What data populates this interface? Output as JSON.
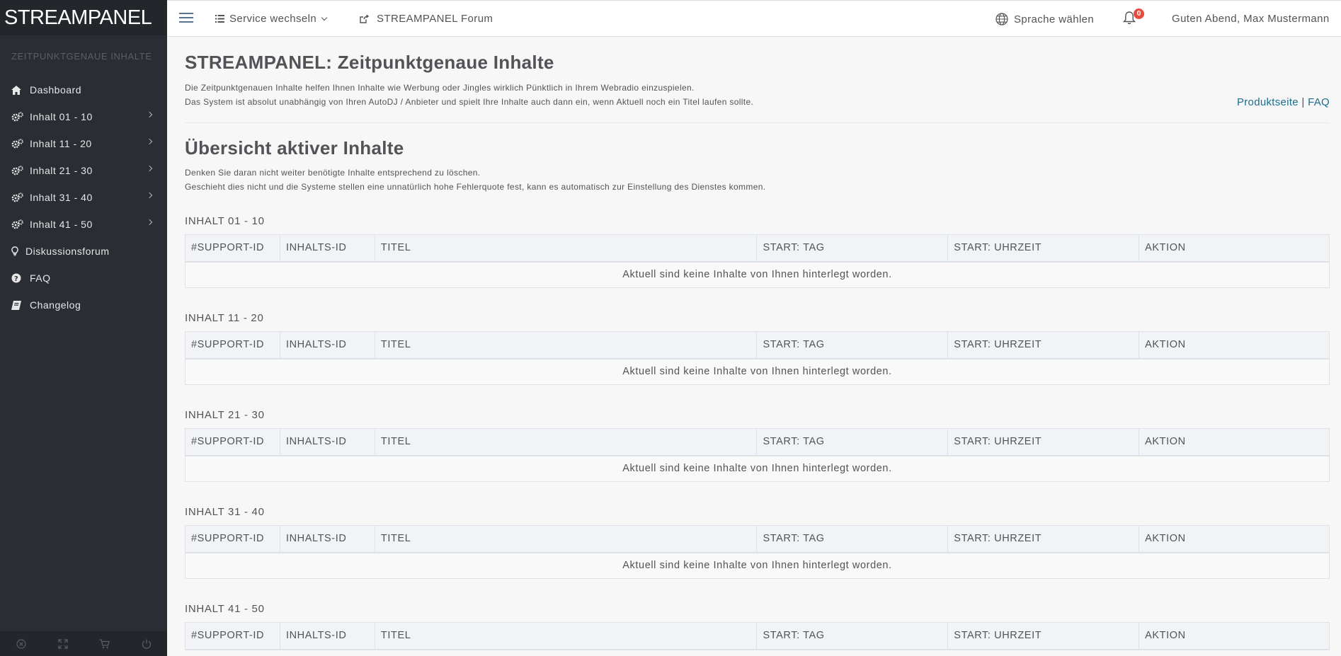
{
  "brand": "STREAMPANEL",
  "sidebar": {
    "section_title": "ZEITPUNKTGENAUE INHALTE",
    "items": [
      {
        "label": "Dashboard",
        "icon": "home-icon"
      },
      {
        "label": "Inhalt 01 - 10",
        "icon": "gears-icon"
      },
      {
        "label": "Inhalt 11 - 20",
        "icon": "gears-icon"
      },
      {
        "label": "Inhalt 21 - 30",
        "icon": "gears-icon"
      },
      {
        "label": "Inhalt 31 - 40",
        "icon": "gears-icon"
      },
      {
        "label": "Inhalt 41 - 50",
        "icon": "gears-icon"
      },
      {
        "label": "Diskussionsforum",
        "icon": "lightbulb-icon"
      },
      {
        "label": "FAQ",
        "icon": "question-circle-icon"
      },
      {
        "label": "Changelog",
        "icon": "book-icon"
      }
    ],
    "footer_icons": [
      "close-circle-icon",
      "fullscreen-icon",
      "cart-icon",
      "power-icon"
    ]
  },
  "topnav": {
    "service_label": "Service wechseln",
    "forum_label": "STREAMPANEL Forum",
    "language_label": "Sprache wählen",
    "notification_count": "0",
    "greeting": "Guten Abend, Max Mustermann"
  },
  "main": {
    "title": "STREAMPANEL: Zeitpunktgenaue Inhalte",
    "intro_line1": "Die Zeitpunktgenauen Inhalte helfen Ihnen Inhalte wie Werbung oder Jingles wirklich Pünktlich in Ihrem Webradio einzuspielen.",
    "intro_line2": "Das System ist absolut unabhängig von Ihren AutoDJ / Anbieter und spielt Ihre Inhalte auch dann ein, wenn Aktuell noch ein Titel laufen sollte.",
    "link_product": "Produktseite",
    "link_sep": "|",
    "link_faq": "FAQ",
    "section_title": "Übersicht aktiver Inhalte",
    "note_line1": "Denken Sie daran nicht weiter benötigte Inhalte entsprechend zu löschen.",
    "note_line2": "Geschieht dies nicht und die Systeme stellen eine unnatürlich hohe Fehlerquote fest, kann es automatisch zur Einstellung des Dienstes kommen.",
    "columns": [
      "#SUPPORT-ID",
      "INHALTS-ID",
      "TITEL",
      "START: TAG",
      "START: UHRZEIT",
      "AKTION"
    ],
    "empty_text": "Aktuell sind keine Inhalte von Ihnen hinterlegt worden.",
    "blocks": [
      {
        "title": "INHALT 01 - 10"
      },
      {
        "title": "INHALT 11 - 20"
      },
      {
        "title": "INHALT 21 - 30"
      },
      {
        "title": "INHALT 31 - 40"
      },
      {
        "title": "INHALT 41 - 50"
      }
    ]
  }
}
